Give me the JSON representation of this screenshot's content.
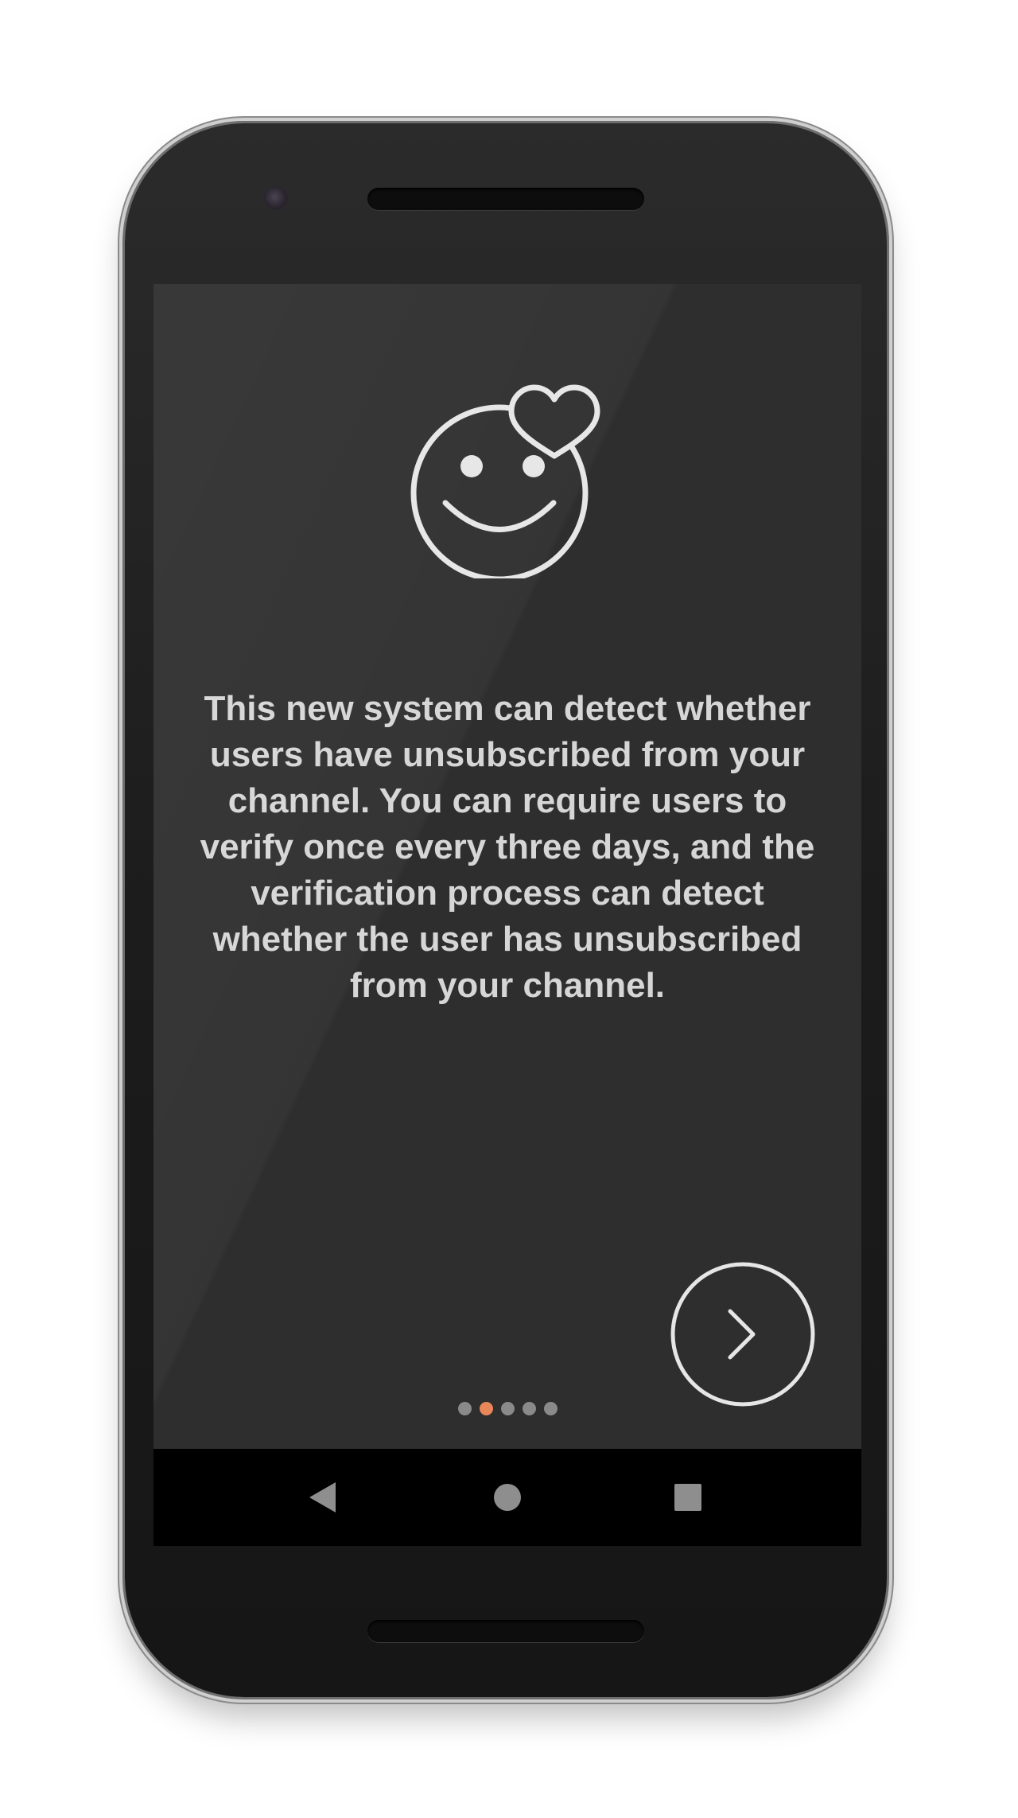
{
  "onboarding": {
    "message": "This new system can detect whether users have unsubscribed from your channel. You can require users to verify once every three days, and the verification process can detect whether the user has unsubscribed from your channel.",
    "hero_icon": "smiley-heart-icon",
    "next_icon": "chevron-right-icon",
    "page_indicator": {
      "total": 5,
      "current": 2
    }
  },
  "navbar": {
    "back_icon": "triangle-back-icon",
    "home_icon": "circle-home-icon",
    "recents_icon": "square-recents-icon"
  },
  "colors": {
    "screen_background": "#2e2e2e",
    "text": "#d6d6d6",
    "icon_stroke": "#e6e6e6",
    "indicator_active": "#e8875a",
    "indicator_inactive": "#8a8a8a",
    "navbar_background": "#000000",
    "navbar_icon": "#8e8e8e"
  }
}
